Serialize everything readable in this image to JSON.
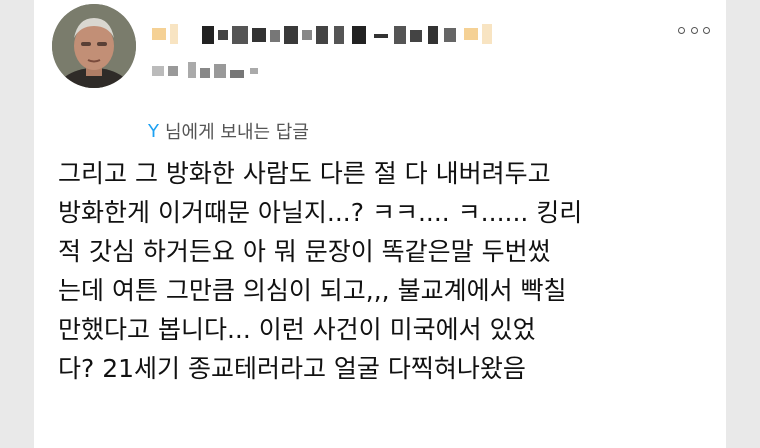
{
  "tweet": {
    "reply": {
      "mention": "Y",
      "text": "님에게 보내는 답글"
    },
    "body_lines": [
      "그리고 그 방화한 사람도 다른 절 다 내버려두고",
      "방화한게 이거때문 아닐지...? ㅋㅋ.... ㅋ...... 킹리",
      "적 갓심 하거든요 아 뭐 문장이 똑같은말 두번썼",
      "는데 여튼 그만큼 의심이 되고,,, 불교계에서 빡칠",
      "만했다고 봅니다... 이런 사건이 미국에서 있었",
      "다? 21세기 종교테러라고 얼굴 다찍혀나왔음"
    ],
    "icons": {
      "more": "more-options-icon",
      "avatar": "user-avatar"
    },
    "colors": {
      "mention": "#1da1f2",
      "text": "#111111",
      "muted": "#555555",
      "background": "#ffffff"
    }
  }
}
